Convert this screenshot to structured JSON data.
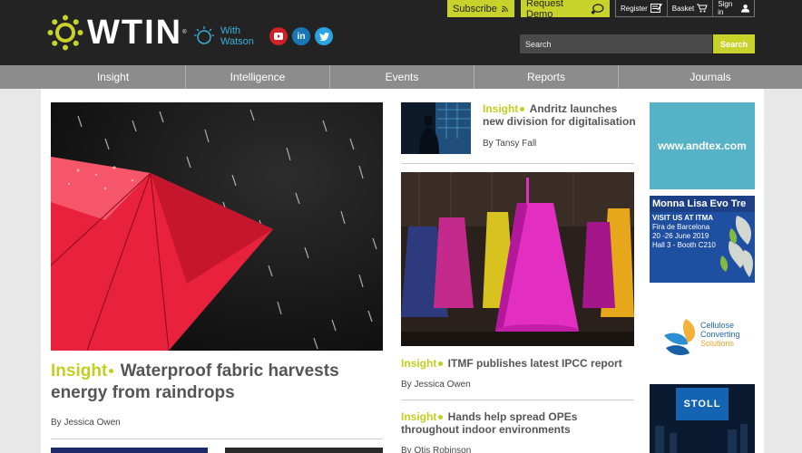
{
  "header": {
    "logo_text": "WTIN",
    "logo_reg": "®",
    "watson_line1": "With",
    "watson_line2": "Watson",
    "subscribe_label": "Subscribe",
    "demo_label": "Request Demo",
    "register_label": "Register",
    "basket_label": "Basket",
    "signin_label": "Sign in",
    "search_placeholder": "Search",
    "search_button": "Search"
  },
  "nav": [
    "Insight",
    "Intelligence",
    "Events",
    "Reports",
    "Journals"
  ],
  "main_article": {
    "kicker": "Insight",
    "title": "Waterproof fabric harvests energy from raindrops",
    "byline": "By Jessica Owen"
  },
  "articles": [
    {
      "kicker": "Insight",
      "title": "Andritz launches new division for digitalisation",
      "byline": "By Tansy Fall"
    },
    {
      "kicker": "Insight",
      "title": "ITMF publishes latest IPCC report",
      "byline": "By Jessica Owen"
    },
    {
      "kicker": "Insight",
      "title": "Hands help spread OPEs throughout indoor environments",
      "byline": "By Otis Robinson"
    }
  ],
  "ads": {
    "andtex": "www.andtex.com",
    "monna_title": "Monna Lisa Evo Tre",
    "monna_l1": "VISIT US AT ITMA",
    "monna_l2": "Fira de Barcelona",
    "monna_l3": "20 -26 June 2019",
    "monna_l4": "Hall 3 - Booth C210",
    "cellulose_l1": "Cellulose",
    "cellulose_l2": "Converting",
    "cellulose_l3": "Solutions",
    "stoll": "STOLL"
  },
  "colors": {
    "accent": "#c7d32a",
    "header_bg": "#232323",
    "nav_bg": "#8c8c8c"
  }
}
